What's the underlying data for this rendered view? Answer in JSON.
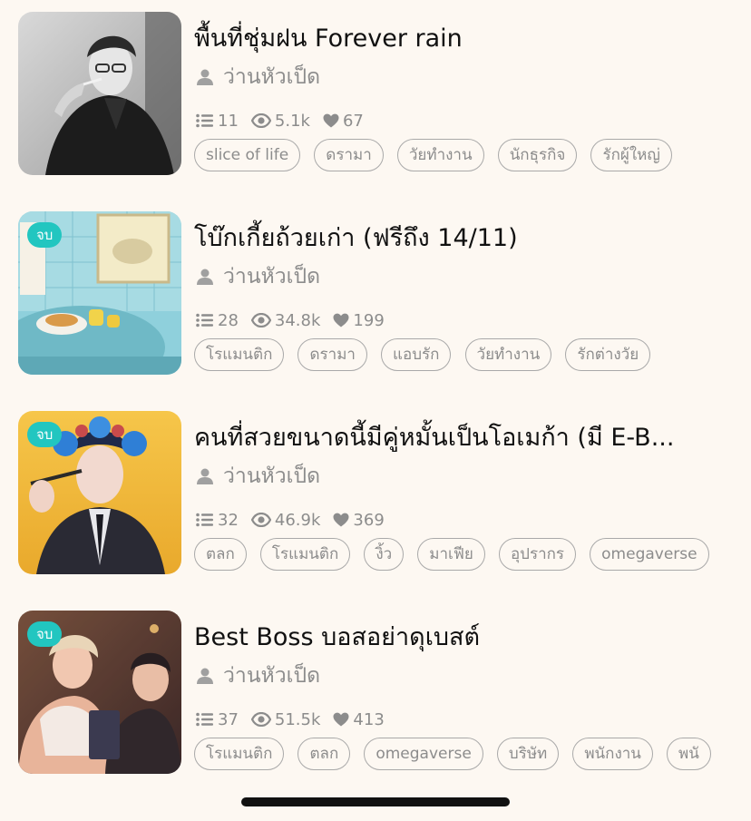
{
  "novels": [
    {
      "title": "พื้นที่ชุ่มฝน Forever rain",
      "author": "ว่านหัวเป็ด",
      "chapters": "11",
      "views": "5.1k",
      "likes": "67",
      "badge": "",
      "tags": [
        "slice of life",
        "ดรามา",
        "วัยทำงาน",
        "นักธุรกิจ",
        "รักผู้ใหญ่"
      ]
    },
    {
      "title": "โบ๊กเกี้ยถ้วยเก่า (ฟรีถึง 14/11)",
      "author": "ว่านหัวเป็ด",
      "chapters": "28",
      "views": "34.8k",
      "likes": "199",
      "badge": "จบ",
      "tags": [
        "โรแมนติก",
        "ดรามา",
        "แอบรัก",
        "วัยทำงาน",
        "รักต่างวัย"
      ]
    },
    {
      "title": "คนที่สวยขนาดนี้มีคู่หมั้นเป็นโอเมก้า (มี E-B...",
      "author": "ว่านหัวเป็ด",
      "chapters": "32",
      "views": "46.9k",
      "likes": "369",
      "badge": "จบ",
      "tags": [
        "ตลก",
        "โรแมนติก",
        "งิ้ว",
        "มาเฟีย",
        "อุปรากร",
        "omegaverse"
      ]
    },
    {
      "title": "Best Boss บอสอย่าดุเบสต์",
      "author": "ว่านหัวเป็ด",
      "chapters": "37",
      "views": "51.5k",
      "likes": "413",
      "badge": "จบ",
      "tags": [
        "โรแมนติก",
        "ตลก",
        "omegaverse",
        "บริษัท",
        "พนักงาน",
        "พนั"
      ]
    }
  ],
  "icons": {
    "author": "person-icon",
    "chapters": "list-icon",
    "views": "eye-icon",
    "likes": "heart-icon"
  },
  "colors": {
    "background": "#fdf8f2",
    "badge": "#22c6c0",
    "muted_text": "#8c8c8c",
    "tag_border": "#a9a9a9"
  }
}
